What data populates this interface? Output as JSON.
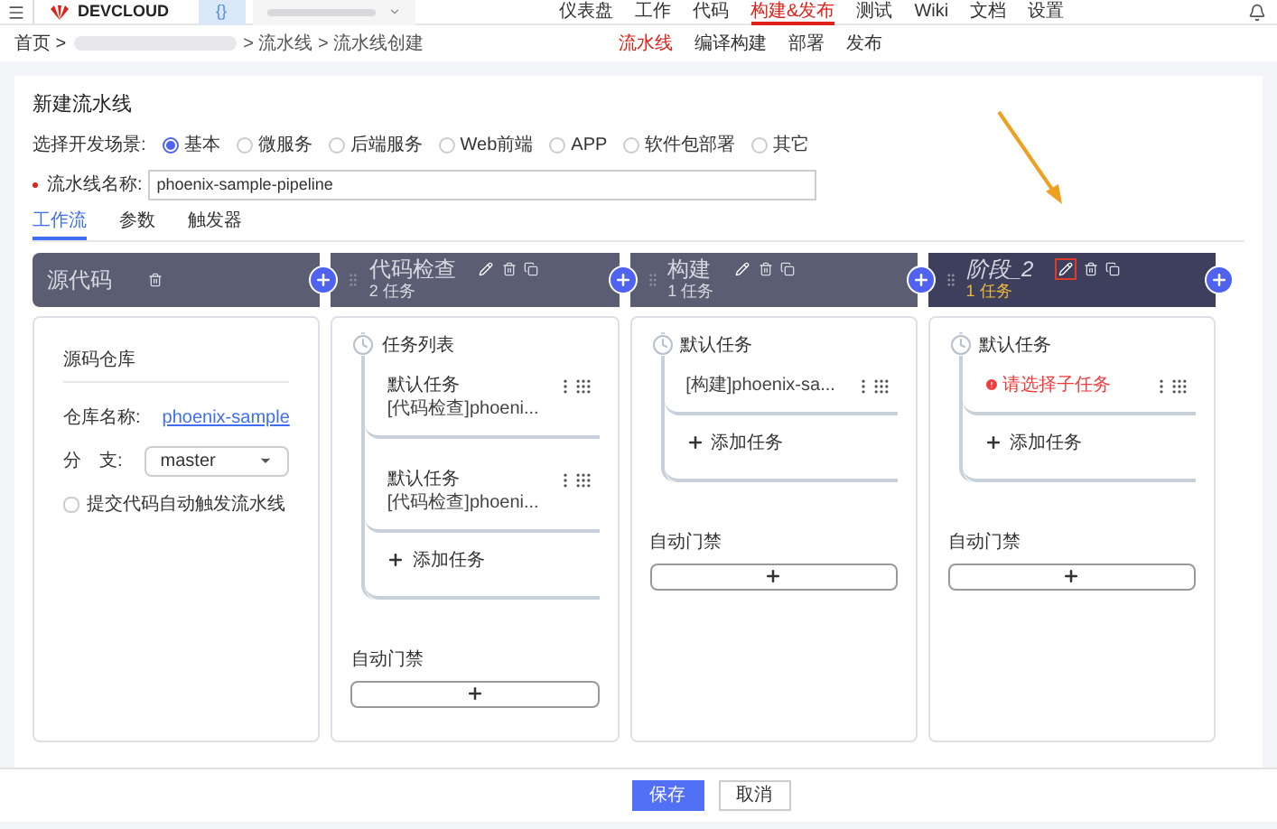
{
  "top_nav": {
    "logo": "DEVCLOUD",
    "brackets": "{}",
    "items": [
      {
        "label": "仪表盘",
        "selected": false
      },
      {
        "label": "工作",
        "selected": false
      },
      {
        "label": "代码",
        "selected": false
      },
      {
        "label": "构建&发布",
        "selected": true
      },
      {
        "label": "测试",
        "selected": false
      },
      {
        "label": "Wiki",
        "selected": false
      },
      {
        "label": "文档",
        "selected": false
      },
      {
        "label": "设置",
        "selected": false
      }
    ]
  },
  "breadcrumb": {
    "home": "首页 >",
    "trail": "> 流水线 > 流水线创建"
  },
  "sub_nav": [
    {
      "label": "流水线",
      "selected": true
    },
    {
      "label": "编译构建",
      "selected": false
    },
    {
      "label": "部署",
      "selected": false
    },
    {
      "label": "发布",
      "selected": false
    }
  ],
  "form": {
    "title": "新建流水线",
    "scene_label": "选择开发场景:",
    "scenes": [
      {
        "label": "基本",
        "selected": true
      },
      {
        "label": "微服务",
        "selected": false
      },
      {
        "label": "后端服务",
        "selected": false
      },
      {
        "label": "Web前端",
        "selected": false
      },
      {
        "label": "APP",
        "selected": false
      },
      {
        "label": "软件包部署",
        "selected": false
      },
      {
        "label": "其它",
        "selected": false
      }
    ],
    "name_label": "流水线名称:",
    "name_required": true,
    "name_value": "phoenix-sample-pipeline"
  },
  "tabs": [
    {
      "label": "工作流",
      "selected": true
    },
    {
      "label": "参数",
      "selected": false
    },
    {
      "label": "触发器",
      "selected": false
    }
  ],
  "stages": [
    {
      "kind": "source",
      "name": "源代码",
      "selected": false,
      "heading": "源码仓库",
      "repo_label": "仓库名称:",
      "repo_link": "phoenix-sample",
      "branch_label": "分　支:",
      "branch_value": "master",
      "trigger_label": "提交代码自动触发流水线",
      "trigger_checked": false
    },
    {
      "kind": "tasks",
      "name": "代码检查",
      "count": "2 任务",
      "selected": false,
      "edit_highlighted": false,
      "group": "任务列表",
      "tasks": [
        {
          "title": "默认任务",
          "detail": "[代码检查]phoeni...",
          "error": false
        },
        {
          "title": "默认任务",
          "detail": "[代码检查]phoeni...",
          "error": false
        }
      ],
      "add_task": "添加任务",
      "gate_label": "自动门禁"
    },
    {
      "kind": "tasks",
      "name": "构建",
      "count": "1 任务",
      "selected": false,
      "edit_highlighted": false,
      "group": "默认任务",
      "tasks": [
        {
          "detail": "[构建]phoenix-sa...",
          "error": false
        }
      ],
      "add_task": "添加任务",
      "gate_label": "自动门禁"
    },
    {
      "kind": "tasks",
      "name": "阶段_2",
      "count": "1 任务",
      "selected": true,
      "edit_highlighted": true,
      "group": "默认任务",
      "tasks": [
        {
          "detail": "请选择子任务",
          "error": true
        }
      ],
      "add_task": "添加任务",
      "gate_label": "自动门禁"
    }
  ],
  "footer": {
    "buttons": [
      {
        "label": "保存",
        "primary": true
      },
      {
        "label": "取消",
        "primary": false
      }
    ]
  }
}
